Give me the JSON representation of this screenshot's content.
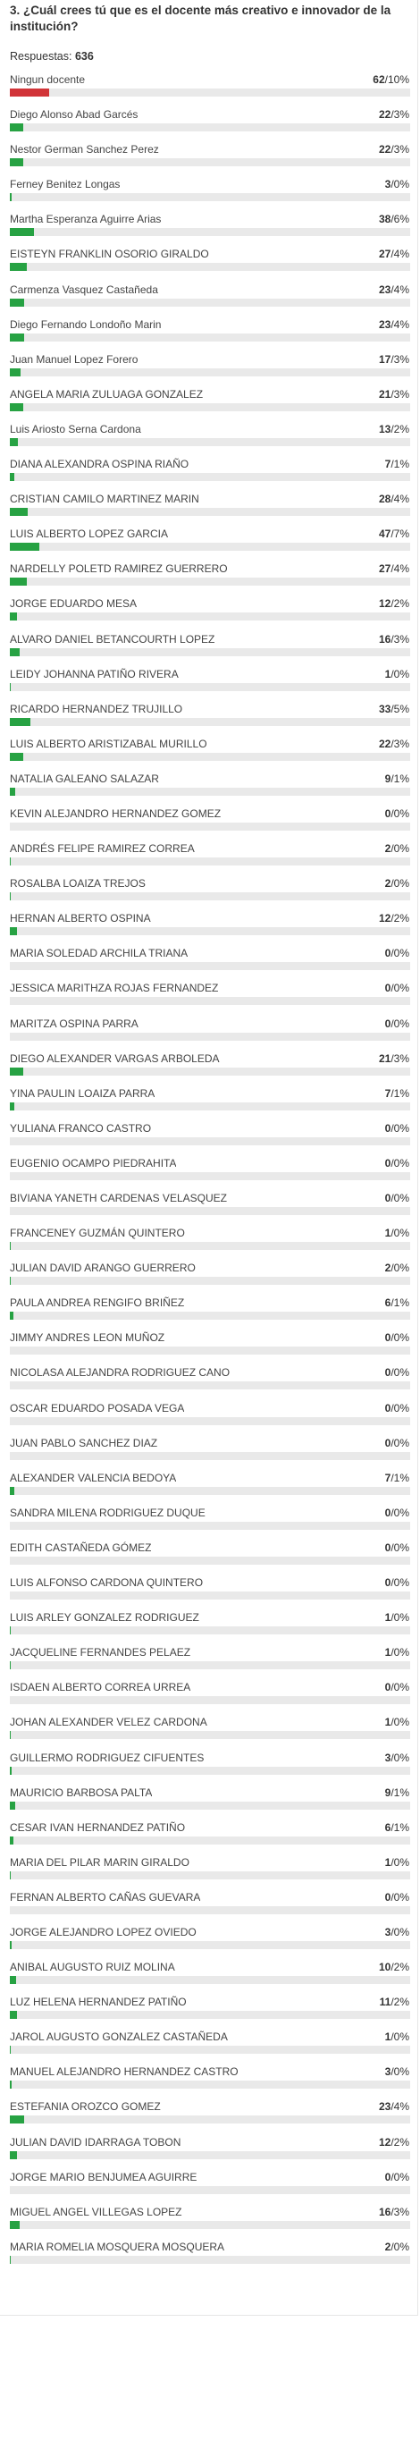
{
  "question": "3. ¿Cuál crees tú que es el docente más creativo e innovador de la institución?",
  "responses_label": "Respuestas:",
  "responses_count": "636",
  "colors": {
    "highlight": "#d13438",
    "normal": "#27a243",
    "track": "#e9e9e9"
  },
  "chart_data": {
    "type": "bar",
    "orientation": "horizontal",
    "title": "3. ¿Cuál crees tú que es el docente más creativo e innovador de la institución?",
    "total_responses": 636,
    "categories": [
      "Ningun docente",
      "Diego Alonso Abad Garcés",
      "Nestor German Sanchez Perez",
      "Ferney Benitez Longas",
      "Martha Esperanza Aguirre Arias",
      "EISTEYN FRANKLIN OSORIO GIRALDO",
      "Carmenza Vasquez Castañeda",
      "Diego Fernando Londoño Marin",
      "Juan Manuel Lopez Forero",
      "ANGELA MARIA ZULUAGA GONZALEZ",
      "Luis Ariosto Serna Cardona",
      "DIANA ALEXANDRA OSPINA RIAÑO",
      "CRISTIAN CAMILO MARTINEZ MARIN",
      "LUIS ALBERTO LOPEZ GARCIA",
      "NARDELLY POLETD RAMIREZ GUERRERO",
      "JORGE EDUARDO MESA",
      "ALVARO DANIEL BETANCOURTH LOPEZ",
      "LEIDY JOHANNA PATIÑO RIVERA",
      "RICARDO HERNANDEZ TRUJILLO",
      "LUIS ALBERTO ARISTIZABAL MURILLO",
      "NATALIA GALEANO SALAZAR",
      "KEVIN ALEJANDRO HERNANDEZ GOMEZ",
      "ANDRÉS FELIPE RAMIREZ CORREA",
      "ROSALBA LOAIZA TREJOS",
      "HERNAN ALBERTO OSPINA",
      "MARIA SOLEDAD ARCHILA TRIANA",
      "JESSICA MARITHZA ROJAS FERNANDEZ",
      "MARITZA OSPINA PARRA",
      "DIEGO ALEXANDER VARGAS ARBOLEDA",
      "YINA PAULIN LOAIZA PARRA",
      "YULIANA FRANCO CASTRO",
      "EUGENIO OCAMPO PIEDRAHITA",
      "BIVIANA YANETH CARDENAS VELASQUEZ",
      "FRANCENEY GUZMÁN QUINTERO",
      "JULIAN DAVID ARANGO GUERRERO",
      "PAULA ANDREA RENGIFO BRIÑEZ",
      "JIMMY ANDRES LEON MUÑOZ",
      "NICOLASA ALEJANDRA RODRIGUEZ CANO",
      "OSCAR EDUARDO POSADA VEGA",
      "JUAN PABLO SANCHEZ DIAZ",
      "ALEXANDER VALENCIA BEDOYA",
      "SANDRA MILENA RODRIGUEZ DUQUE",
      "EDITH CASTAÑEDA GÓMEZ",
      "LUIS ALFONSO CARDONA QUINTERO",
      "LUIS ARLEY GONZALEZ RODRIGUEZ",
      "JACQUELINE FERNANDES PELAEZ",
      "ISDAEN ALBERTO CORREA URREA",
      "JOHAN ALEXANDER VELEZ CARDONA",
      "GUILLERMO RODRIGUEZ CIFUENTES",
      "MAURICIO BARBOSA PALTA",
      "CESAR IVAN HERNANDEZ PATIÑO",
      "MARIA DEL PILAR MARIN GIRALDO",
      "FERNAN ALBERTO CAÑAS GUEVARA",
      "JORGE ALEJANDRO LOPEZ OVIEDO",
      "ANIBAL AUGUSTO RUIZ MOLINA",
      "LUZ HELENA HERNANDEZ PATIÑO",
      "JAROL AUGUSTO GONZALEZ CASTAÑEDA",
      "MANUEL ALEJANDRO HERNANDEZ CASTRO",
      "ESTEFANIA OROZCO GOMEZ",
      "JULIAN DAVID IDARRAGA TOBON",
      "JORGE MARIO BENJUMEA AGUIRRE",
      "MIGUEL ANGEL VILLEGAS LOPEZ",
      "MARIA ROMELIA MOSQUERA MOSQUERA"
    ],
    "values": [
      62,
      22,
      22,
      3,
      38,
      27,
      23,
      23,
      17,
      21,
      13,
      7,
      28,
      47,
      27,
      12,
      16,
      1,
      33,
      22,
      9,
      0,
      2,
      2,
      12,
      0,
      0,
      0,
      21,
      7,
      0,
      0,
      0,
      1,
      2,
      6,
      0,
      0,
      0,
      0,
      7,
      0,
      0,
      0,
      1,
      1,
      0,
      1,
      3,
      9,
      6,
      1,
      0,
      3,
      10,
      11,
      1,
      3,
      23,
      12,
      0,
      16,
      2
    ],
    "percents": [
      "10%",
      "3%",
      "3%",
      "0%",
      "6%",
      "4%",
      "4%",
      "4%",
      "3%",
      "3%",
      "2%",
      "1%",
      "4%",
      "7%",
      "4%",
      "2%",
      "3%",
      "0%",
      "5%",
      "3%",
      "1%",
      "0%",
      "0%",
      "0%",
      "2%",
      "0%",
      "0%",
      "0%",
      "3%",
      "1%",
      "0%",
      "0%",
      "0%",
      "0%",
      "0%",
      "1%",
      "0%",
      "0%",
      "0%",
      "0%",
      "1%",
      "0%",
      "0%",
      "0%",
      "0%",
      "0%",
      "0%",
      "0%",
      "0%",
      "1%",
      "1%",
      "0%",
      "0%",
      "0%",
      "2%",
      "2%",
      "0%",
      "0%",
      "4%",
      "2%",
      "0%",
      "3%",
      "0%"
    ],
    "highlight_index": 0
  }
}
